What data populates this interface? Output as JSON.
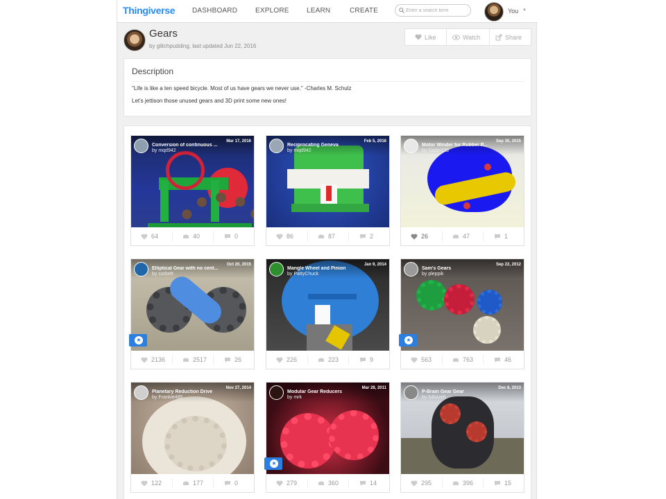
{
  "nav": {
    "logo": "Thingiverse",
    "links": [
      "DASHBOARD",
      "EXPLORE",
      "LEARN",
      "CREATE"
    ],
    "search_placeholder": "Enter a search term",
    "user": "You"
  },
  "header": {
    "title": "Gears",
    "byline": "by glitchpudding, last updated Jun 22, 2016",
    "like": "Like",
    "watch": "Watch",
    "share": "Share"
  },
  "description": {
    "heading": "Description",
    "line1": "\"Life is like a ten speed bicycle. Most of us have gears we never use.\" -Charles M. Schulz",
    "line2": "Let's jettison those unused gears and 3D print some new ones!"
  },
  "things": [
    {
      "title": "Conversion of continuous ...",
      "author": "by mqd942",
      "date": "Mar 17, 2016",
      "likes": "64",
      "collects": "40",
      "comments": "0",
      "featured": false
    },
    {
      "title": "Reciprocating Geneva",
      "author": "by mqd942",
      "date": "Feb 5, 2016",
      "likes": "86",
      "collects": "87",
      "comments": "2",
      "featured": false
    },
    {
      "title": "Motor Winder for Rubber P...",
      "author": "by Sadie123",
      "date": "Sep 30, 2015",
      "likes": "26",
      "collects": "47",
      "comments": "1",
      "featured": false
    },
    {
      "title": "Elliptical Gear with no cent...",
      "author": "by corbett",
      "date": "Oct 20, 2015",
      "likes": "2136",
      "collects": "2517",
      "comments": "26",
      "featured": true
    },
    {
      "title": "Mangle Wheel and Pinion",
      "author": "by PattyChuck",
      "date": "Jan 9, 2014",
      "likes": "226",
      "collects": "223",
      "comments": "9",
      "featured": false
    },
    {
      "title": "Sam's Gears",
      "author": "by pleppik",
      "date": "Sep 22, 2012",
      "likes": "563",
      "collects": "763",
      "comments": "46",
      "featured": true
    },
    {
      "title": "Planetary Reduction Drive",
      "author": "by Frankie485",
      "date": "Nov 27, 2014",
      "likes": "122",
      "collects": "177",
      "comments": "0",
      "featured": false
    },
    {
      "title": "Modular Gear Reducers",
      "author": "by mrk",
      "date": "Mar 28, 2011",
      "likes": "279",
      "collects": "360",
      "comments": "14",
      "featured": true
    },
    {
      "title": "P-Brain Gear Gear",
      "author": "by fullsizeh",
      "date": "Dec 8, 2013",
      "likes": "295",
      "collects": "396",
      "comments": "15",
      "featured": false
    }
  ],
  "colors": {
    "brand": "#248bfb",
    "featured": "#2b7fe0"
  }
}
